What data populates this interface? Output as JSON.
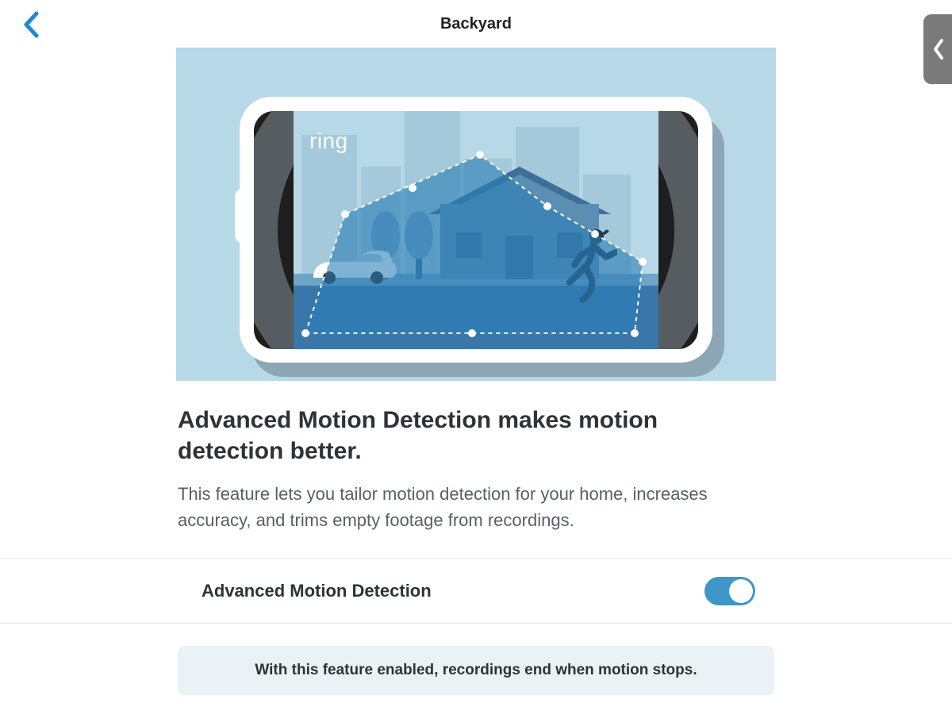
{
  "header": {
    "title": "Backyard"
  },
  "hero": {
    "logo_text": "ring"
  },
  "feature": {
    "heading": "Advanced Motion Detection makes motion detection better.",
    "description": "This feature lets you tailor motion detection for your home, increases accuracy, and trims empty footage from recordings."
  },
  "setting": {
    "label": "Advanced Motion Detection",
    "enabled": true
  },
  "info_banner": "With this feature enabled, recordings end when motion stops.",
  "colors": {
    "accent": "#3e96c8",
    "hero_bg": "#b7d8e7"
  }
}
